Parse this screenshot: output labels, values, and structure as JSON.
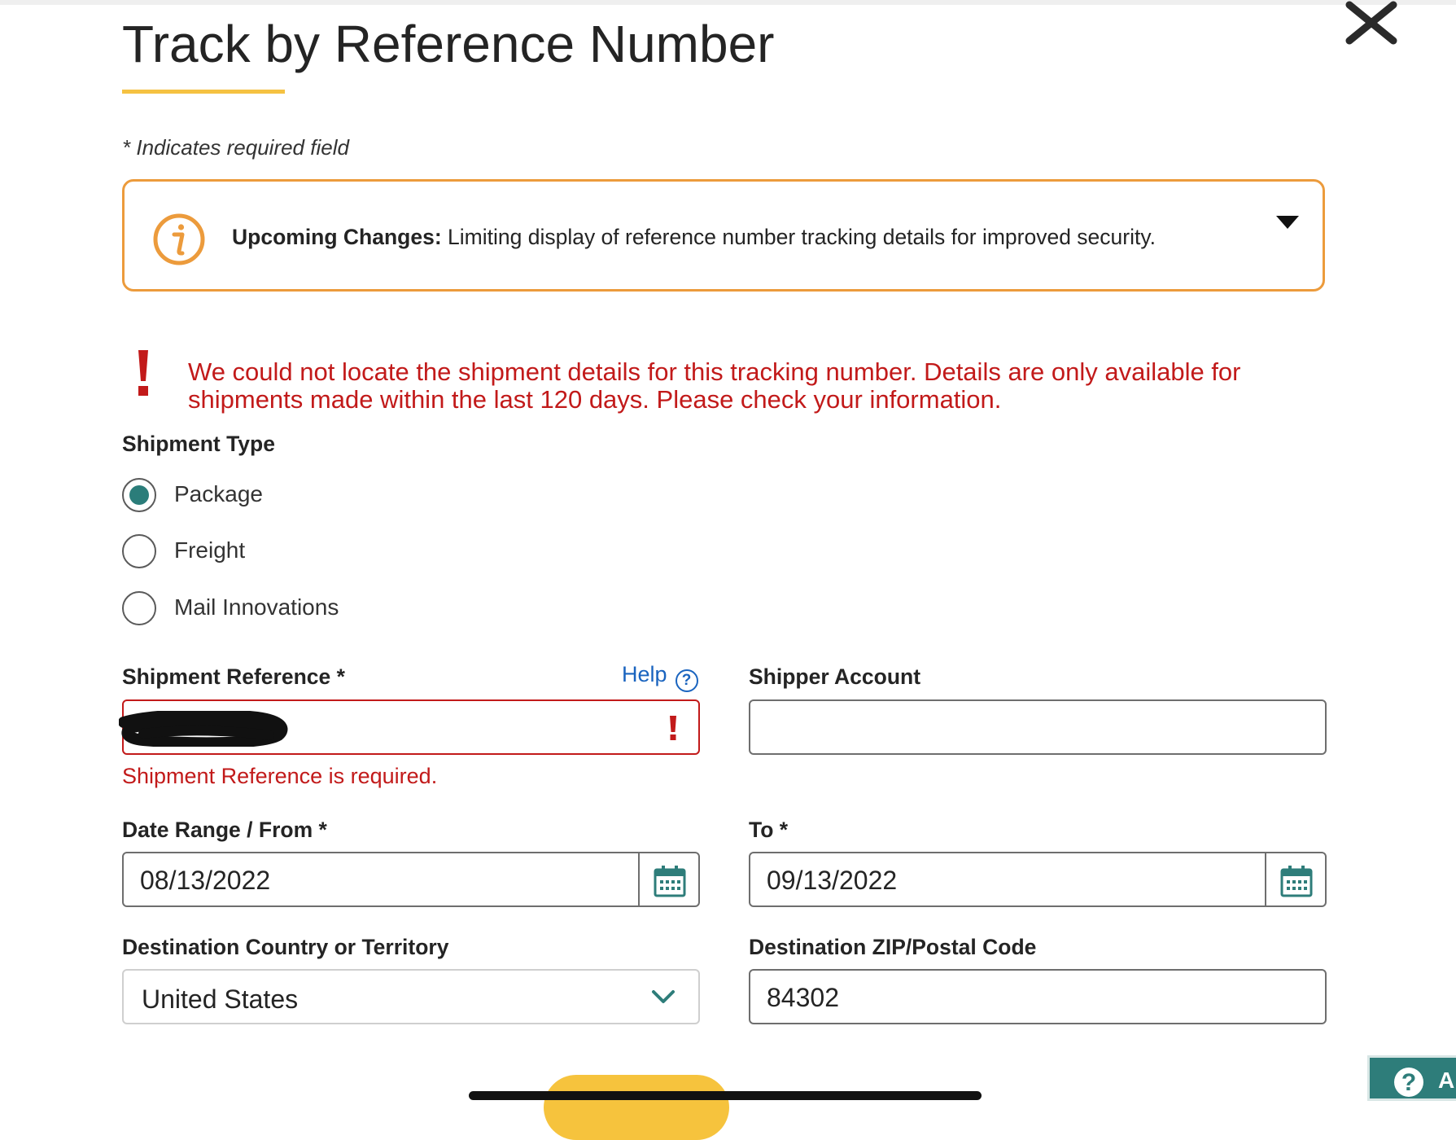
{
  "page": {
    "title": "Track by Reference Number",
    "required_note": "* Indicates required field"
  },
  "notice": {
    "heading": "Upcoming Changes:",
    "message": "Limiting display of reference number tracking details for improved security.",
    "icon": "info-circle-icon",
    "toggle_icon": "caret-down-icon",
    "accent_color": "#ec9b3c"
  },
  "error": {
    "message": "We could not locate the shipment details for this tracking number. Details are only available for shipments made within the last 120 days. Please check your information.",
    "color": "#c21a1a"
  },
  "shipment_type": {
    "label": "Shipment Type",
    "options": [
      {
        "label": "Package",
        "selected": true
      },
      {
        "label": "Freight",
        "selected": false
      },
      {
        "label": "Mail Innovations",
        "selected": false
      }
    ]
  },
  "form": {
    "shipment_reference": {
      "label": "Shipment Reference *",
      "help_label": "Help",
      "value": "",
      "error": "Shipment Reference is required."
    },
    "shipper_account": {
      "label": "Shipper Account",
      "value": ""
    },
    "date_from": {
      "label": "Date Range / From *",
      "value": "08/13/2022"
    },
    "date_to": {
      "label": "To *",
      "value": "09/13/2022"
    },
    "destination_country": {
      "label": "Destination Country or Territory",
      "value": "United States"
    },
    "destination_zip": {
      "label": "Destination ZIP/Postal Code",
      "value": "84302"
    }
  },
  "help_fab": {
    "label": "A"
  },
  "colors": {
    "brand_yellow": "#f5c242",
    "teal": "#2b7d7a",
    "link_blue": "#1a64bf"
  }
}
